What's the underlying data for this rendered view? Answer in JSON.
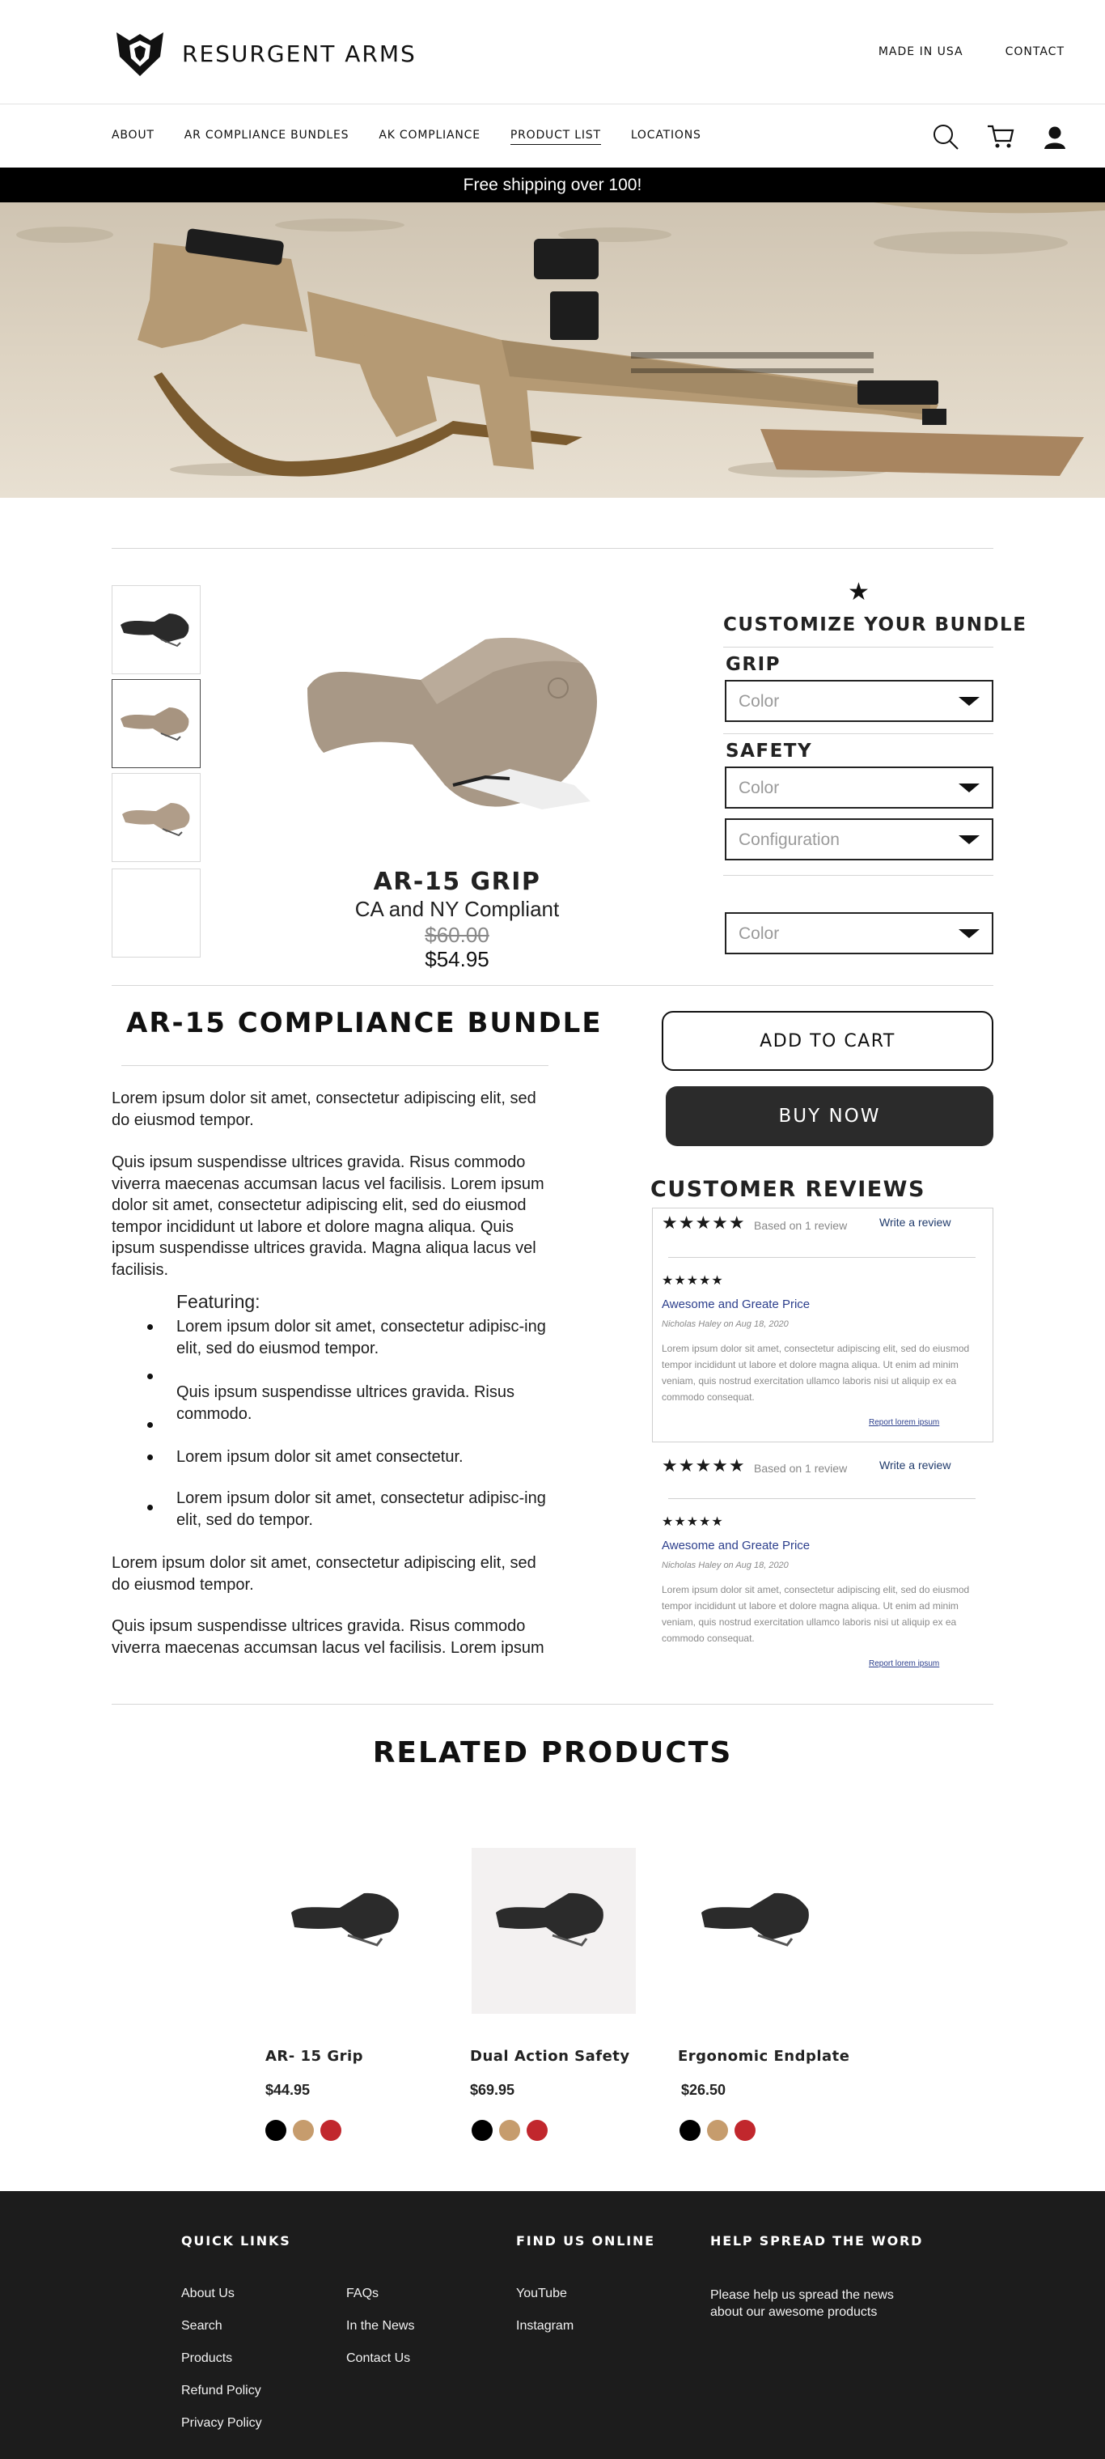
{
  "header": {
    "brand": "RESURGENT ARMS",
    "top_links": [
      "MADE IN USA",
      "CONTACT"
    ]
  },
  "nav": {
    "items": [
      "ABOUT",
      "AR COMPLIANCE BUNDLES",
      "AK COMPLIANCE",
      "PRODUCT LIST",
      "LOCATIONS"
    ],
    "active": "PRODUCT LIST",
    "icons": [
      "search-icon",
      "cart-icon",
      "user-icon"
    ]
  },
  "banner": {
    "text": "Free shipping over 100!"
  },
  "product": {
    "name": "AR-15 GRIP",
    "subtitle": "CA and NY Compliant",
    "old_price": "$60.00",
    "price": "$54.95",
    "thumbnails": 4,
    "selected_thumbnail": 2
  },
  "customize": {
    "title": "CUSTOMIZE YOUR BUNDLE",
    "grip_label": "GRIP",
    "safety_label": "SAFETY",
    "grip_color_placeholder": "Color",
    "safety_color_placeholder": "Color",
    "safety_config_placeholder": "Configuration",
    "extra_color_placeholder": "Color"
  },
  "bundle": {
    "title": "AR-15 COMPLIANCE BUNDLE",
    "para1": "Lorem ipsum dolor sit amet, consectetur adipiscing elit, sed do eiusmod tempor.",
    "para2": "Quis ipsum suspendisse ultrices gravida. Risus commodo viverra maecenas accumsan lacus vel facilisis. Lorem ipsum dolor sit amet, consectetur adipiscing elit, sed do eiusmod tempor incididunt ut labore et dolore magna aliqua. Quis ipsum suspendisse ultrices gravida. Magna aliqua lacus vel facilisis.",
    "featuring_label": "Featuring:",
    "features": [
      "Lorem ipsum dolor sit amet, consectetur adipisc-ing elit, sed do eiusmod tempor.",
      "Quis ipsum suspendisse ultrices gravida. Risus commodo.",
      "Lorem ipsum dolor sit amet consectetur.",
      "Lorem ipsum dolor sit amet, consectetur adipisc-ing elit, sed do tempor."
    ],
    "para3": "Lorem ipsum dolor sit amet, consectetur adipiscing elit, sed do eiusmod tempor.",
    "para4": "Quis ipsum suspendisse ultrices gravida. Risus commodo viverra maecenas accumsan lacus vel facilisis. Lorem ipsum"
  },
  "actions": {
    "add_to_cart": "ADD TO CART",
    "buy_now": "BUY NOW"
  },
  "reviews": {
    "title": "CUSTOMER REVIEWS",
    "summary_stars": "★★★★★",
    "based_on": "Based on 1 review",
    "write_review": "Write a review",
    "items": [
      {
        "stars": "★★★★★",
        "headline": "Awesome and Greate Price",
        "author": "Nicholas Haley",
        "on": "on",
        "date": "Aug 18, 2020",
        "body": "Lorem ipsum dolor sit amet, consectetur adipiscing elit, sed do eiusmod tempor incididunt ut labore et dolore magna aliqua. Ut enim ad minim veniam, quis nostrud exercitation ullamco laboris nisi ut aliquip ex ea commodo consequat.",
        "report": "Report lorem ipsum"
      }
    ]
  },
  "related": {
    "title": "RELATED PRODUCTS",
    "items": [
      {
        "name": "AR- 15 Grip",
        "price": "$44.95"
      },
      {
        "name": "Dual Action Safety",
        "price": "$69.95"
      },
      {
        "name": "Ergonomic Endplate",
        "price": "$26.50"
      }
    ],
    "swatch_colors": [
      "#000000",
      "#c69c6d",
      "#c1272d"
    ]
  },
  "footer": {
    "quick_links_title": "QUICK LINKS",
    "quick_links_col1": [
      "About Us",
      "Search",
      "Products",
      "Refund Policy",
      "Privacy Policy"
    ],
    "quick_links_col2": [
      "FAQs",
      "In the News",
      "Contact Us"
    ],
    "find_us_title": "FIND US ONLINE",
    "find_us_links": [
      "YouTube",
      "Instagram"
    ],
    "spread_title": "HELP SPREAD THE WORD",
    "spread_text": "Please help us spread the news about our awesome products"
  }
}
